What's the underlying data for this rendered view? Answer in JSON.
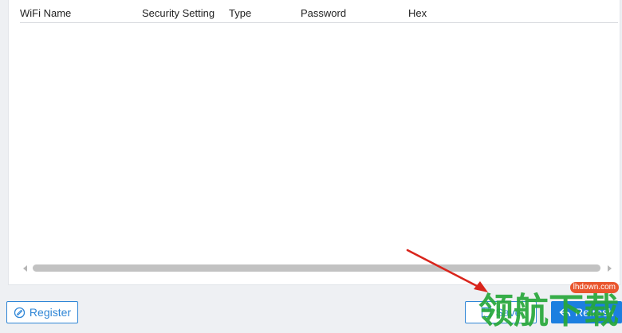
{
  "table": {
    "columns": [
      "WiFi Name",
      "Security Setting",
      "Type",
      "Password",
      "Hex"
    ],
    "rows": []
  },
  "buttons": {
    "register_label": "Register",
    "save_label": "Save",
    "refresh_label": "Refresh"
  },
  "watermark": {
    "text": "领航下载",
    "badge": "lhdown.com"
  },
  "colors": {
    "accent": "#1c7fe0",
    "outline": "#2f86d6",
    "watermark_green": "#27a83a",
    "annotation_red": "#d9251c"
  },
  "icons": {
    "register": "register-icon",
    "save": "save-icon",
    "refresh": "refresh-icon"
  }
}
